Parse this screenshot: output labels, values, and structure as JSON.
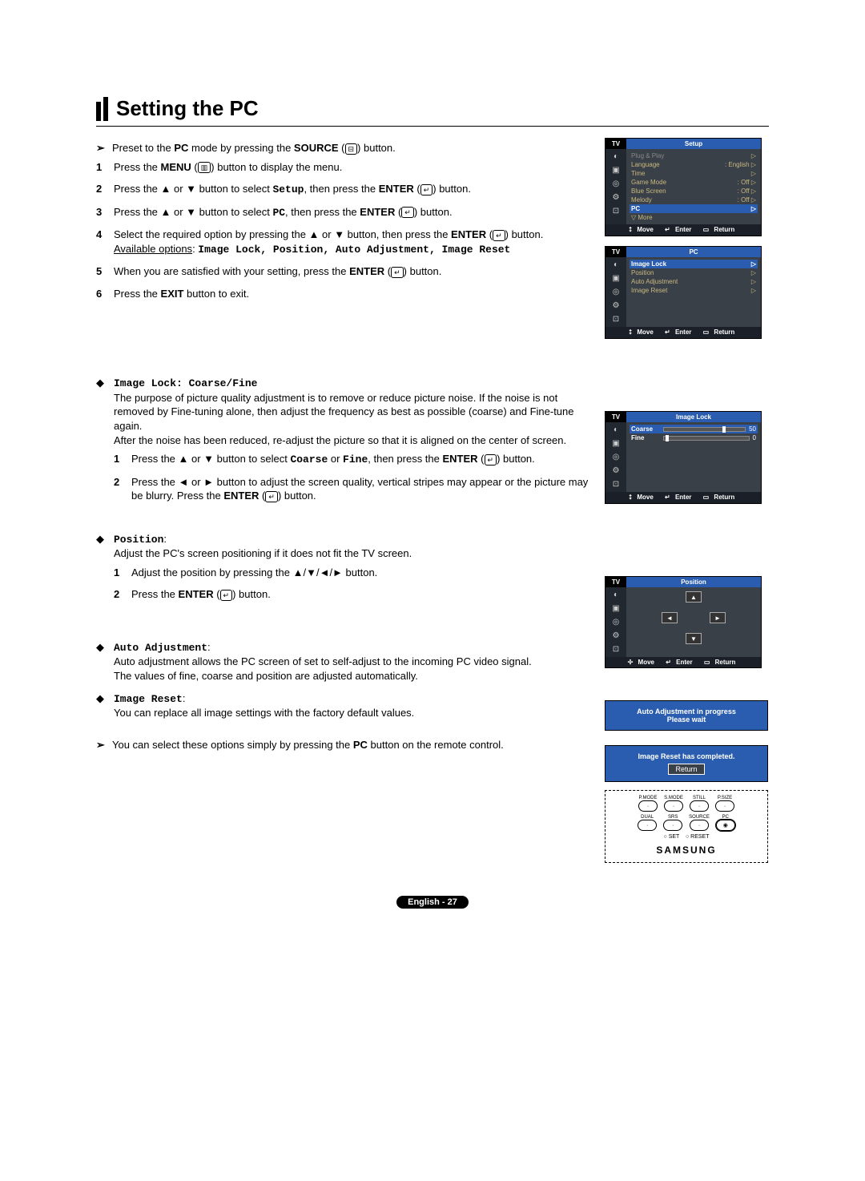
{
  "title": "Setting the PC",
  "intro": {
    "preset_a": "Preset to the ",
    "preset_b": " mode by pressing the ",
    "pc": "PC",
    "source": "SOURCE",
    "button_suffix": " button."
  },
  "steps": [
    {
      "num": "1",
      "a": "Press the ",
      "b": "MENU",
      "c": " (",
      "d": ") button to display the menu."
    },
    {
      "num": "2",
      "a": "Press the ▲ or ▼ button to select ",
      "opt": "Setup",
      "b": ", then press the ",
      "c": "ENTER",
      "d": " button."
    },
    {
      "num": "3",
      "a": "Press the ▲ or ▼ button to select ",
      "opt": "PC",
      "b": ", then press the ",
      "c": "ENTER",
      "d": " button."
    },
    {
      "num": "4",
      "a": "Select the required option by pressing the ▲ or ▼ button, then press the ",
      "b": "ENTER",
      "c": " button.",
      "avail_label": "Available options",
      "avail_opts": "Image Lock, Position, Auto Adjustment, Image Reset"
    },
    {
      "num": "5",
      "a": "When you are satisfied with your setting, press the ",
      "b": "ENTER",
      "c": " button."
    },
    {
      "num": "6",
      "a": "Press the ",
      "b": "EXIT",
      "c": " button to exit."
    }
  ],
  "image_lock": {
    "heading": "Image Lock: Coarse/Fine",
    "p": "The purpose of picture quality adjustment is to remove or reduce picture noise. If the noise is not removed by Fine-tuning alone, then adjust the frequency as best as possible (coarse) and Fine-tune again.\nAfter the noise has been reduced, re-adjust the picture so that it is aligned on the center of screen.",
    "s1a": "Press the ▲ or ▼ button to select ",
    "s1_coarse": "Coarse",
    "s1_or": " or ",
    "s1_fine": "Fine",
    "s1b": ", then press the ",
    "s1_enter": "ENTER",
    "s1c": " button.",
    "s2a": "Press the ◄ or ► button to adjust the screen quality, vertical stripes may appear or the picture may be blurry. Press the ",
    "s2_enter": "ENTER",
    "s2b": " button."
  },
  "position": {
    "heading": "Position",
    "p": "Adjust the PC's screen positioning if it does not fit the TV screen.",
    "s1": "Adjust the position by pressing the ▲/▼/◄/► button.",
    "s2a": "Press the ",
    "s2_enter": "ENTER",
    "s2b": " button."
  },
  "auto_adjustment": {
    "heading": "Auto Adjustment",
    "p": "Auto adjustment allows the PC screen of set to self-adjust to the incoming PC video signal.\nThe values of fine, coarse and position are adjusted automatically."
  },
  "image_reset": {
    "heading": "Image Reset",
    "p": "You can replace all image settings with the factory default values."
  },
  "tip": {
    "a": "You can select these options simply by pressing the ",
    "b": "PC",
    "c": " button on the remote control."
  },
  "osd_setup": {
    "tv": "TV",
    "title": "Setup",
    "rows": [
      {
        "l": "Plug & Play",
        "r": "",
        "dis": true,
        "tri": true
      },
      {
        "l": "Language",
        "r": ": English",
        "tri": true
      },
      {
        "l": "Time",
        "r": "",
        "tri": true
      },
      {
        "l": "Game Mode",
        "r": ": Off",
        "tri": true
      },
      {
        "l": "Blue Screen",
        "r": ": Off",
        "tri": true
      },
      {
        "l": "Melody",
        "r": ": Off",
        "tri": true
      },
      {
        "l": "PC",
        "r": "",
        "sel": true,
        "tri": true
      },
      {
        "l": "▽ More",
        "r": ""
      }
    ],
    "footer": {
      "move": "Move",
      "enter": "Enter",
      "return": "Return"
    }
  },
  "osd_pc": {
    "tv": "TV",
    "title": "PC",
    "rows": [
      {
        "l": "Image Lock",
        "sel": true,
        "tri": true
      },
      {
        "l": "Position",
        "tri": true
      },
      {
        "l": "Auto Adjustment",
        "tri": true
      },
      {
        "l": "Image Reset",
        "tri": true
      }
    ],
    "footer": {
      "move": "Move",
      "enter": "Enter",
      "return": "Return"
    }
  },
  "osd_imagelock": {
    "tv": "TV",
    "title": "Image Lock",
    "sliders": [
      {
        "l": "Coarse",
        "v": "50",
        "pos": 72,
        "sel": true
      },
      {
        "l": "Fine",
        "v": "0",
        "pos": 2
      }
    ],
    "footer": {
      "move": "Move",
      "enter": "Enter",
      "return": "Return"
    }
  },
  "osd_position": {
    "tv": "TV",
    "title": "Position",
    "footer": {
      "move": "Move",
      "enter": "Enter",
      "return": "Return"
    }
  },
  "msg_auto": "Auto Adjustment in progress\nPlease wait",
  "msg_reset": "Image Reset has completed.",
  "msg_return": "Return",
  "remote": {
    "row1": [
      "P.MODE",
      "S.MODE",
      "STILL",
      "P.SIZE"
    ],
    "row2": [
      "DUAL",
      "SRS",
      "SOURCE",
      "PC"
    ],
    "dots": {
      "set": "SET",
      "reset": "RESET"
    },
    "brand": "SAMSUNG"
  },
  "footer_page": "English - 27",
  "glyphs": {
    "arrow": "➢",
    "diamond": "◆",
    "updown": "⭥",
    "enter_sym": "↵",
    "return_sym": "▭",
    "source_icon": "⊟",
    "menu_icon": "▥",
    "enter_icon": "↵",
    "dot": "○",
    "dot_fill": "◉"
  }
}
